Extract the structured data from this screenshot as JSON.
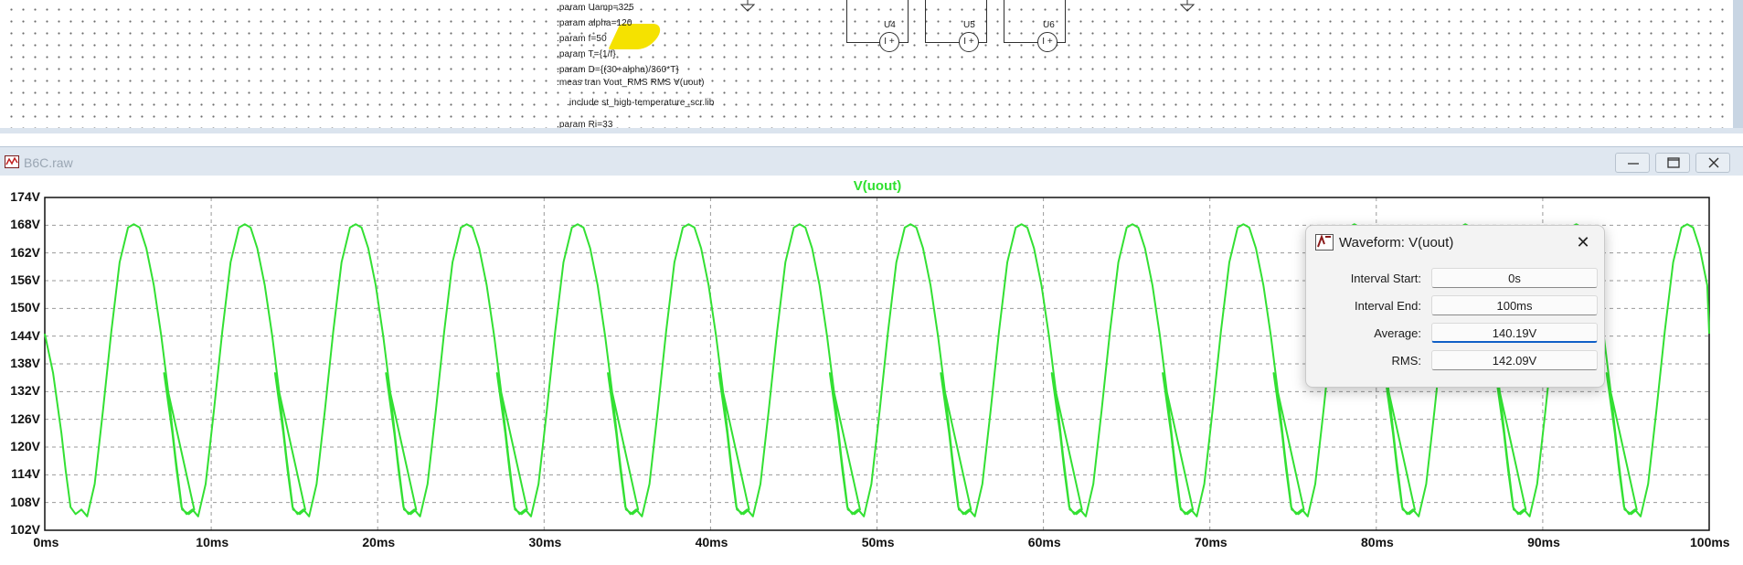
{
  "schematic": {
    "directives": [
      ".param Uamp=325",
      ".param alpha=120",
      ".param f=50",
      ".param T={1/f}",
      ".param D={(30+alpha)/360*T}",
      ".meas tran Vout_RMS RMS V(uout)",
      ".include st_high-temperature_scr.lib",
      ".param Ri=33"
    ],
    "sources": [
      {
        "label": "U4",
        "symbol": "I +"
      },
      {
        "label": "U5",
        "symbol": "I +"
      },
      {
        "label": "U6",
        "symbol": "I +"
      }
    ],
    "highlight_color": "#f5e200"
  },
  "window": {
    "title": "B6C.raw",
    "minimize_icon": "minimize-icon",
    "maximize_icon": "maximize-icon",
    "close_icon": "close-icon"
  },
  "plot": {
    "trace_color": "#33e033",
    "grid_color": "#9a9a9a"
  },
  "chart_data": {
    "type": "line",
    "title": "V(uout)",
    "xlabel": "",
    "ylabel": "",
    "x_ticks": [
      "0ms",
      "10ms",
      "20ms",
      "30ms",
      "40ms",
      "50ms",
      "60ms",
      "70ms",
      "80ms",
      "90ms",
      "100ms"
    ],
    "y_ticks": [
      "174V",
      "168V",
      "162V",
      "156V",
      "150V",
      "144V",
      "138V",
      "132V",
      "126V",
      "120V",
      "114V",
      "108V",
      "102V"
    ],
    "xlim_ms": [
      0,
      100
    ],
    "ylim_V": [
      102,
      174
    ],
    "grid": true,
    "series": [
      {
        "name": "V(uout)",
        "color": "#33e033",
        "x_ms": [
          0,
          0.5,
          1,
          1.25,
          1.55,
          1.85,
          2.2,
          2.55,
          3,
          3.5,
          4,
          4.5,
          5,
          5.35,
          5.7,
          6.1,
          6.55,
          7,
          7.45,
          7.85,
          8.25,
          8.65,
          8.98
        ],
        "v": [
          144.5,
          136,
          123,
          115,
          107,
          105.5,
          106.5,
          105,
          112,
          128,
          145,
          160,
          167.5,
          168.2,
          167.5,
          163,
          155,
          144,
          131,
          118,
          106.5,
          105.5,
          106.5
        ],
        "period_ms": 6.6667,
        "end_value_v": 144.5
      }
    ]
  },
  "dialog": {
    "title": "Waveform: V(uout)",
    "icon": "ltspice-icon",
    "close_label": "✕",
    "rows": [
      {
        "label": "Interval Start:",
        "value": "0s"
      },
      {
        "label": "Interval End:",
        "value": "100ms"
      },
      {
        "label": "Average:",
        "value": "140.19V"
      },
      {
        "label": "RMS:",
        "value": "142.09V"
      }
    ]
  }
}
